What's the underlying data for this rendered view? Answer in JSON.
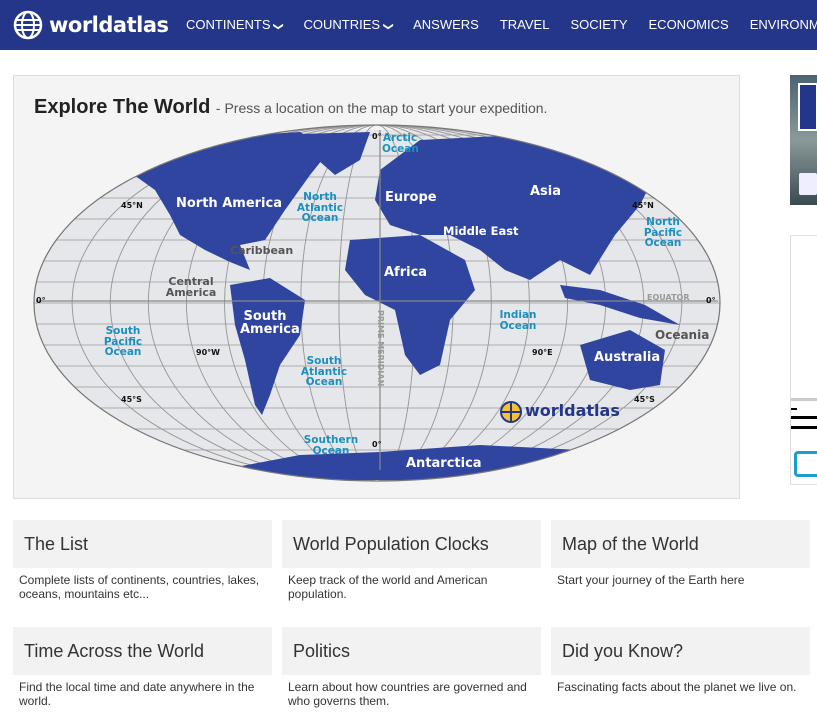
{
  "nav": {
    "logo": "worldatlas",
    "items": [
      "CONTINENTS",
      "COUNTRIES",
      "ANSWERS",
      "TRAVEL",
      "SOCIETY",
      "ECONOMICS",
      "ENVIRONMENT"
    ]
  },
  "colors": {
    "nav": "#233689",
    "land": "#2f45a0",
    "ocean_label": "#1a8fc0"
  },
  "explore": {
    "title": "Explore The World",
    "subtitle": "- Press a location on the map to start your expedition."
  },
  "map": {
    "continents": {
      "north_america": "North America",
      "south_america": "South America",
      "europe": "Europe",
      "asia": "Asia",
      "africa": "Africa",
      "middle_east": "Middle East",
      "australia": "Australia",
      "antarctica": "Antarctica",
      "oceania": "Oceania"
    },
    "oceans": {
      "arctic": "Arctic Ocean",
      "north_atlantic": "North Atlantic Ocean",
      "north_pacific": "North Pacific Ocean",
      "south_pacific": "South Pacific Ocean",
      "south_atlantic": "South Atlantic Ocean",
      "indian": "Indian Ocean",
      "southern": "Southern Ocean"
    },
    "regions": {
      "caribbean": "Caribbean",
      "central_america": "Central America"
    },
    "lines": {
      "equator": "EQUATOR",
      "prime_meridian": "PRIME MERIDIAN",
      "lat45n": "45°N",
      "lat45s": "45°S",
      "lon90w": "90°W",
      "lon90e": "90°E",
      "zero": "0°"
    },
    "logo": "worldatlas"
  },
  "cards": [
    {
      "title": "The List",
      "desc": "Complete lists of continents, countries, lakes, oceans, mountains etc..."
    },
    {
      "title": "World Population Clocks",
      "desc": "Keep track of the world and American population."
    },
    {
      "title": "Map of the World",
      "desc": "Start your journey of the Earth here"
    },
    {
      "title": "Time Across the World",
      "desc": "Find the local time and date anywhere in the world."
    },
    {
      "title": "Politics",
      "desc": "Learn about how countries are governed and who governs them."
    },
    {
      "title": "Did you Know?",
      "desc": "Fascinating facts about the planet we live on."
    }
  ]
}
